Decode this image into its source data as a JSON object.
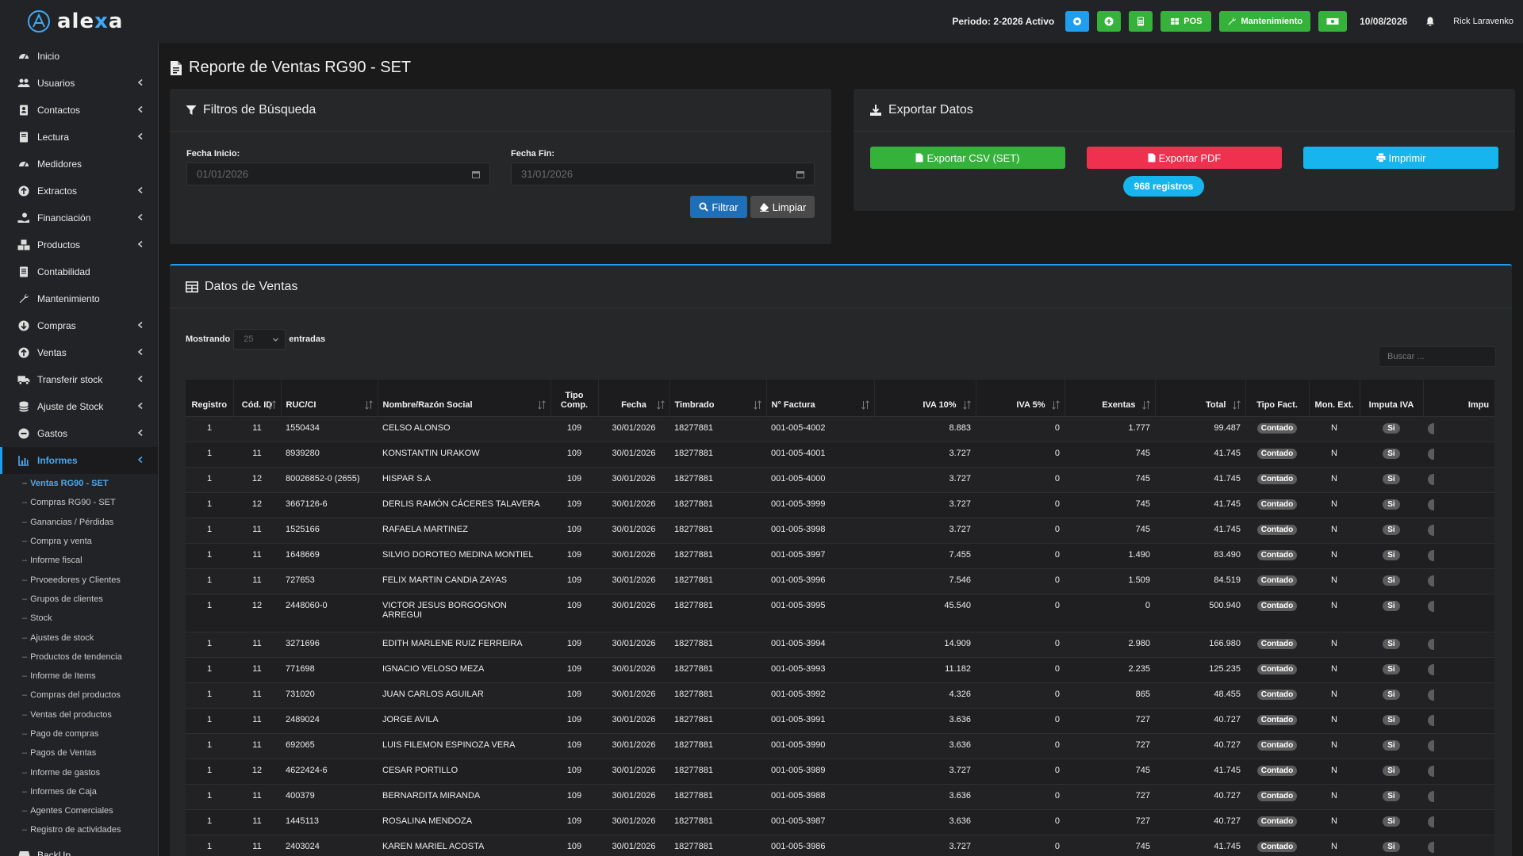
{
  "app": {
    "brand": "alexa"
  },
  "topbar": {
    "periodo": "Periodo: 2-2026 Activo",
    "pos_label": "POS",
    "mantenimiento_label": "Mantenimiento",
    "date": "10/08/2026",
    "user": "Rick Laravenko",
    "colors": {
      "blue": "#1f9ef0",
      "green": "#35b23a"
    }
  },
  "sidebar": {
    "items": [
      {
        "label": "Inicio",
        "icon": "dashboard-icon",
        "chevron": false
      },
      {
        "label": "Usuarios",
        "icon": "users-icon",
        "chevron": true
      },
      {
        "label": "Contactos",
        "icon": "address-book-icon",
        "chevron": true
      },
      {
        "label": "Lectura",
        "icon": "book-icon",
        "chevron": true
      },
      {
        "label": "Medidores",
        "icon": "gauge-icon",
        "chevron": false
      },
      {
        "label": "Extractos",
        "icon": "arrow-circle-up-icon",
        "chevron": true
      },
      {
        "label": "Financiación",
        "icon": "hand-money-icon",
        "chevron": true
      },
      {
        "label": "Productos",
        "icon": "cubes-icon",
        "chevron": true
      },
      {
        "label": "Contabilidad",
        "icon": "ledger-icon",
        "chevron": false
      },
      {
        "label": "Mantenimiento",
        "icon": "wrench-icon",
        "chevron": false
      },
      {
        "label": "Compras",
        "icon": "arrow-circle-down-icon",
        "chevron": true
      },
      {
        "label": "Ventas",
        "icon": "arrow-circle-up-icon",
        "chevron": true
      },
      {
        "label": "Transferir stock",
        "icon": "truck-icon",
        "chevron": true
      },
      {
        "label": "Ajuste de Stock",
        "icon": "database-icon",
        "chevron": true
      },
      {
        "label": "Gastos",
        "icon": "minus-circle-icon",
        "chevron": true
      }
    ],
    "active_item": {
      "label": "Informes",
      "icon": "chart-icon"
    },
    "sub_items": [
      "Ventas RG90 - SET",
      "Compras RG90 - SET",
      "Ganancias / Pérdidas",
      "Compra y venta",
      "Informe fiscal",
      "Prvoeedores y Clientes",
      "Grupos de clientes",
      "Stock",
      "Ajustes de stock",
      "Productos de tendencia",
      "Informe de Items",
      "Compras del productos",
      "Ventas del productos",
      "Pago de compras",
      "Pagos de Ventas",
      "Informe de gastos",
      "Informes de Caja",
      "Agentes Comerciales",
      "Registro de actividades"
    ],
    "backup": "BackUp"
  },
  "page": {
    "title": "Reporte de Ventas RG90 - SET"
  },
  "filters": {
    "title": "Filtros de Búsqueda",
    "fecha_inicio_label": "Fecha Inicio:",
    "fecha_inicio_value": "01/01/2026",
    "fecha_fin_label": "Fecha Fin:",
    "fecha_fin_value": "31/01/2026",
    "filtrar": "Filtrar",
    "limpiar": "Limpiar"
  },
  "export": {
    "title": "Exportar Datos",
    "csv": "Exportar CSV (SET)",
    "pdf": "Exportar PDF",
    "print": "Imprimir",
    "registros": "968 registros",
    "colors": {
      "csv": "#35b23a",
      "pdf": "#f0304f",
      "print": "#16b5ee"
    }
  },
  "ventas": {
    "title": "Datos de Ventas",
    "mostrando": "Mostrando",
    "entradas": "entradas",
    "page_length": "25",
    "search_placeholder": "Buscar ...",
    "columns": [
      "Registro",
      "Cód. ID",
      "RUC/CI",
      "Nombre/Razón Social",
      "Tipo Comp.",
      "Fecha",
      "Timbrado",
      "N° Factura",
      "IVA 10%",
      "IVA 5%",
      "Exentas",
      "Total",
      "Tipo Fact.",
      "Mon. Ext.",
      "Imputa IVA",
      "Impu"
    ],
    "rows": [
      {
        "registro": "1",
        "cod": "11",
        "ruc": "1550434",
        "nombre": "CELSO ALONSO",
        "tipo": "109",
        "fecha": "30/01/2026",
        "timbrado": "18277881",
        "factura": "001-005-4002",
        "iva10": "8.883",
        "iva5": "0",
        "exentas": "1.777",
        "total": "99.487",
        "tipo_fact": "Contado",
        "mon_ext": "N",
        "imputa": "Si"
      },
      {
        "registro": "1",
        "cod": "11",
        "ruc": "8939280",
        "nombre": "KONSTANTIN URAKOW",
        "tipo": "109",
        "fecha": "30/01/2026",
        "timbrado": "18277881",
        "factura": "001-005-4001",
        "iva10": "3.727",
        "iva5": "0",
        "exentas": "745",
        "total": "41.745",
        "tipo_fact": "Contado",
        "mon_ext": "N",
        "imputa": "Si"
      },
      {
        "registro": "1",
        "cod": "12",
        "ruc": "80026852-0 (2655)",
        "nombre": "HISPAR S.A",
        "tipo": "109",
        "fecha": "30/01/2026",
        "timbrado": "18277881",
        "factura": "001-005-4000",
        "iva10": "3.727",
        "iva5": "0",
        "exentas": "745",
        "total": "41.745",
        "tipo_fact": "Contado",
        "mon_ext": "N",
        "imputa": "Si"
      },
      {
        "registro": "1",
        "cod": "12",
        "ruc": "3667126-6",
        "nombre": "DERLIS RAMÓN CÁCERES TALAVERA",
        "tipo": "109",
        "fecha": "30/01/2026",
        "timbrado": "18277881",
        "factura": "001-005-3999",
        "iva10": "3.727",
        "iva5": "0",
        "exentas": "745",
        "total": "41.745",
        "tipo_fact": "Contado",
        "mon_ext": "N",
        "imputa": "Si"
      },
      {
        "registro": "1",
        "cod": "11",
        "ruc": "1525166",
        "nombre": "RAFAELA MARTINEZ",
        "tipo": "109",
        "fecha": "30/01/2026",
        "timbrado": "18277881",
        "factura": "001-005-3998",
        "iva10": "3.727",
        "iva5": "0",
        "exentas": "745",
        "total": "41.745",
        "tipo_fact": "Contado",
        "mon_ext": "N",
        "imputa": "Si"
      },
      {
        "registro": "1",
        "cod": "11",
        "ruc": "1648669",
        "nombre": "SILVIO DOROTEO MEDINA MONTIEL",
        "tipo": "109",
        "fecha": "30/01/2026",
        "timbrado": "18277881",
        "factura": "001-005-3997",
        "iva10": "7.455",
        "iva5": "0",
        "exentas": "1.490",
        "total": "83.490",
        "tipo_fact": "Contado",
        "mon_ext": "N",
        "imputa": "Si"
      },
      {
        "registro": "1",
        "cod": "11",
        "ruc": "727653",
        "nombre": "FELIX MARTIN CANDIA ZAYAS",
        "tipo": "109",
        "fecha": "30/01/2026",
        "timbrado": "18277881",
        "factura": "001-005-3996",
        "iva10": "7.546",
        "iva5": "0",
        "exentas": "1.509",
        "total": "84.519",
        "tipo_fact": "Contado",
        "mon_ext": "N",
        "imputa": "Si"
      },
      {
        "registro": "1",
        "cod": "12",
        "ruc": "2448060-0",
        "nombre": "VICTOR JESUS BORGOGNON ARREGUI",
        "tipo": "109",
        "fecha": "30/01/2026",
        "timbrado": "18277881",
        "factura": "001-005-3995",
        "iva10": "45.540",
        "iva5": "0",
        "exentas": "0",
        "total": "500.940",
        "tipo_fact": "Contado",
        "mon_ext": "N",
        "imputa": "Si"
      },
      {
        "registro": "1",
        "cod": "11",
        "ruc": "3271696",
        "nombre": "EDITH MARLENE RUIZ FERREIRA",
        "tipo": "109",
        "fecha": "30/01/2026",
        "timbrado": "18277881",
        "factura": "001-005-3994",
        "iva10": "14.909",
        "iva5": "0",
        "exentas": "2.980",
        "total": "166.980",
        "tipo_fact": "Contado",
        "mon_ext": "N",
        "imputa": "Si"
      },
      {
        "registro": "1",
        "cod": "11",
        "ruc": "771698",
        "nombre": "IGNACIO VELOSO MEZA",
        "tipo": "109",
        "fecha": "30/01/2026",
        "timbrado": "18277881",
        "factura": "001-005-3993",
        "iva10": "11.182",
        "iva5": "0",
        "exentas": "2.235",
        "total": "125.235",
        "tipo_fact": "Contado",
        "mon_ext": "N",
        "imputa": "Si"
      },
      {
        "registro": "1",
        "cod": "11",
        "ruc": "731020",
        "nombre": "JUAN CARLOS AGUILAR",
        "tipo": "109",
        "fecha": "30/01/2026",
        "timbrado": "18277881",
        "factura": "001-005-3992",
        "iva10": "4.326",
        "iva5": "0",
        "exentas": "865",
        "total": "48.455",
        "tipo_fact": "Contado",
        "mon_ext": "N",
        "imputa": "Si"
      },
      {
        "registro": "1",
        "cod": "11",
        "ruc": "2489024",
        "nombre": "JORGE AVILA",
        "tipo": "109",
        "fecha": "30/01/2026",
        "timbrado": "18277881",
        "factura": "001-005-3991",
        "iva10": "3.636",
        "iva5": "0",
        "exentas": "727",
        "total": "40.727",
        "tipo_fact": "Contado",
        "mon_ext": "N",
        "imputa": "Si"
      },
      {
        "registro": "1",
        "cod": "11",
        "ruc": "692065",
        "nombre": "LUIS FILEMON ESPINOZA VERA",
        "tipo": "109",
        "fecha": "30/01/2026",
        "timbrado": "18277881",
        "factura": "001-005-3990",
        "iva10": "3.636",
        "iva5": "0",
        "exentas": "727",
        "total": "40.727",
        "tipo_fact": "Contado",
        "mon_ext": "N",
        "imputa": "Si"
      },
      {
        "registro": "1",
        "cod": "12",
        "ruc": "4622424-6",
        "nombre": "CESAR PORTILLO",
        "tipo": "109",
        "fecha": "30/01/2026",
        "timbrado": "18277881",
        "factura": "001-005-3989",
        "iva10": "3.727",
        "iva5": "0",
        "exentas": "745",
        "total": "41.745",
        "tipo_fact": "Contado",
        "mon_ext": "N",
        "imputa": "Si"
      },
      {
        "registro": "1",
        "cod": "11",
        "ruc": "400379",
        "nombre": "BERNARDITA MIRANDA",
        "tipo": "109",
        "fecha": "30/01/2026",
        "timbrado": "18277881",
        "factura": "001-005-3988",
        "iva10": "3.636",
        "iva5": "0",
        "exentas": "727",
        "total": "40.727",
        "tipo_fact": "Contado",
        "mon_ext": "N",
        "imputa": "Si"
      },
      {
        "registro": "1",
        "cod": "11",
        "ruc": "1445113",
        "nombre": "ROSALINA MENDOZA",
        "tipo": "109",
        "fecha": "30/01/2026",
        "timbrado": "18277881",
        "factura": "001-005-3987",
        "iva10": "3.636",
        "iva5": "0",
        "exentas": "727",
        "total": "40.727",
        "tipo_fact": "Contado",
        "mon_ext": "N",
        "imputa": "Si"
      },
      {
        "registro": "1",
        "cod": "11",
        "ruc": "2403024",
        "nombre": "KAREN MARIEL ACOSTA",
        "tipo": "109",
        "fecha": "30/01/2026",
        "timbrado": "18277881",
        "factura": "001-005-3986",
        "iva10": "3.727",
        "iva5": "0",
        "exentas": "745",
        "total": "41.745",
        "tipo_fact": "Contado",
        "mon_ext": "N",
        "imputa": "Si"
      }
    ]
  }
}
